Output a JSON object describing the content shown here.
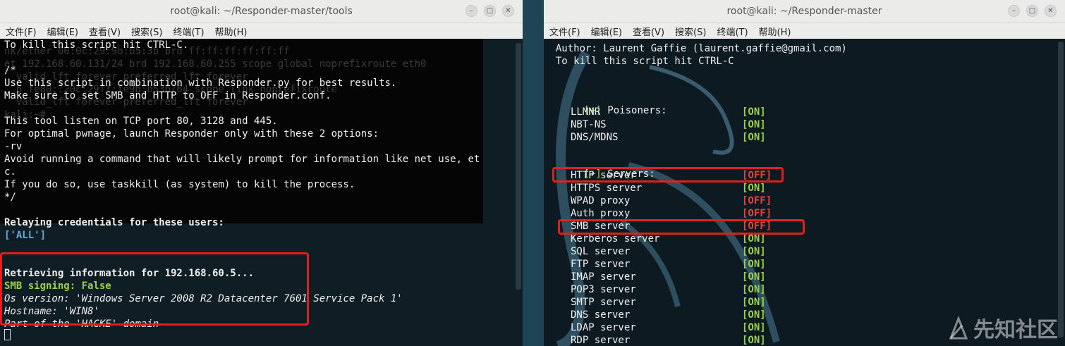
{
  "left_window": {
    "title": "root@kali: ~/Responder-master/tools",
    "menu": [
      "文件(F)",
      "编辑(E)",
      "查看(V)",
      "搜索(S)",
      "终端(T)",
      "帮助(H)"
    ],
    "background_lines": [
      "nk/ether 00:0c:29:9b:b5:3b brd ff:ff:ff:ff:ff:ff",
      "et 192.168.60.131/24 brd 192.168.60.255 scope global noprefixroute eth0",
      "  valid_lft forever preferred_lft forever",
      "  6 fe80::20c:29ff:fe9b:b53b/64 scope link noprefixroute",
      "  valid_lft forever preferred_lft forever",
      "kali:~# "
    ],
    "lines": [
      "To kill this script hit CTRL-C.",
      "",
      "/*",
      "Use this script in combination with Responder.py for best results.",
      "Make sure to set SMB and HTTP to OFF in Responder.conf.",
      "",
      "This tool listen on TCP port 80, 3128 and 445.",
      "For optimal pwnage, launch Responder only with these 2 options:",
      "-rv",
      "Avoid running a command that will likely prompt for information like net use, et",
      "c.",
      "If you do so, use taskkill (as system) to kill the process.",
      "*/",
      "",
      "Relaying credentials for these users:",
      "['ALL']",
      "",
      "",
      "Retrieving information for 192.168.60.5...",
      "SMB signing: False",
      "Os version: 'Windows Server 2008 R2 Datacenter 7601 Service Pack 1'",
      "Hostname: 'WIN8'",
      "Part of the 'HACKE' domain"
    ]
  },
  "right_window": {
    "title": "root@kali: ~/Responder-master",
    "menu": [
      "文件(F)",
      "编辑(E)",
      "查看(V)",
      "搜索(S)",
      "终端(T)",
      "帮助(H)"
    ],
    "author_line": "  Author: Laurent Gaffie (laurent.gaffie@gmail.com)",
    "kill_line": "  To kill this script hit CTRL-C",
    "poisoners_marker": "[+]",
    "poisoners_label": " Poisoners:",
    "poisoners": [
      {
        "name": "LLMNR",
        "state": "[ON]"
      },
      {
        "name": "NBT-NS",
        "state": "[ON]"
      },
      {
        "name": "DNS/MDNS",
        "state": "[ON]"
      }
    ],
    "servers_marker": "[+]",
    "servers_label": " Servers:",
    "servers": [
      {
        "name": "HTTP server",
        "state": "[OFF]"
      },
      {
        "name": "HTTPS server",
        "state": "[ON]"
      },
      {
        "name": "WPAD proxy",
        "state": "[OFF]"
      },
      {
        "name": "Auth proxy",
        "state": "[OFF]"
      },
      {
        "name": "SMB server",
        "state": "[OFF]"
      },
      {
        "name": "Kerberos server",
        "state": "[ON]"
      },
      {
        "name": "SQL server",
        "state": "[ON]"
      },
      {
        "name": "FTP server",
        "state": "[ON]"
      },
      {
        "name": "IMAP server",
        "state": "[ON]"
      },
      {
        "name": "POP3 server",
        "state": "[ON]"
      },
      {
        "name": "SMTP server",
        "state": "[ON]"
      },
      {
        "name": "DNS server",
        "state": "[ON]"
      },
      {
        "name": "LDAP server",
        "state": "[ON]"
      },
      {
        "name": "RDP server",
        "state": "[ON]"
      }
    ]
  },
  "watermark": {
    "text": "先知社区"
  },
  "colors": {
    "on": "#9ad14b",
    "off": "#e3443c",
    "annotation": "#e02020"
  }
}
